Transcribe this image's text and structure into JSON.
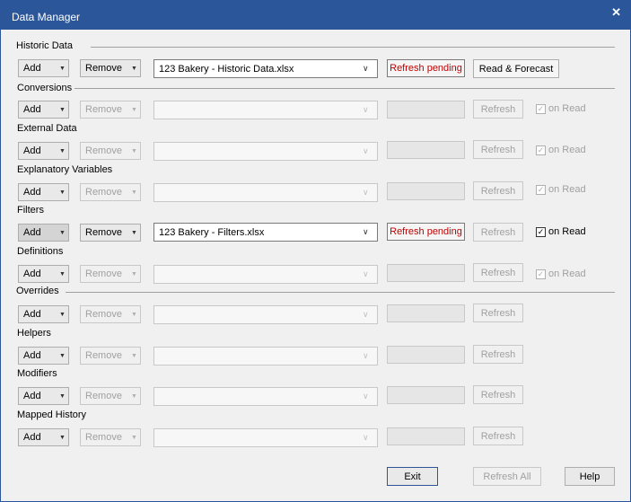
{
  "window": {
    "title": "Data Manager",
    "close_glyph": "✕"
  },
  "sections": {
    "historic": "Historic Data",
    "overrides": "Overrides"
  },
  "common": {
    "add": "Add",
    "remove": "Remove",
    "refresh": "Refresh",
    "on_read": "on Read",
    "check_glyph": "✓",
    "arrow_small": "▼",
    "arrow_combo": "∨"
  },
  "historic": {
    "file": "123 Bakery - Historic Data.xlsx",
    "status": "Refresh pending",
    "read_forecast": "Read & Forecast"
  },
  "sublabels": {
    "conversions": "Conversions",
    "external": "External Data",
    "explanatory": "Explanatory Variables",
    "filters": "Filters",
    "definitions": "Definitions",
    "helpers": "Helpers",
    "modifiers": "Modifiers",
    "mapped": "Mapped History"
  },
  "filters": {
    "file": "123 Bakery - Filters.xlsx",
    "status": "Refresh pending"
  },
  "footer": {
    "exit": "Exit",
    "refresh_all": "Refresh All",
    "help": "Help"
  }
}
